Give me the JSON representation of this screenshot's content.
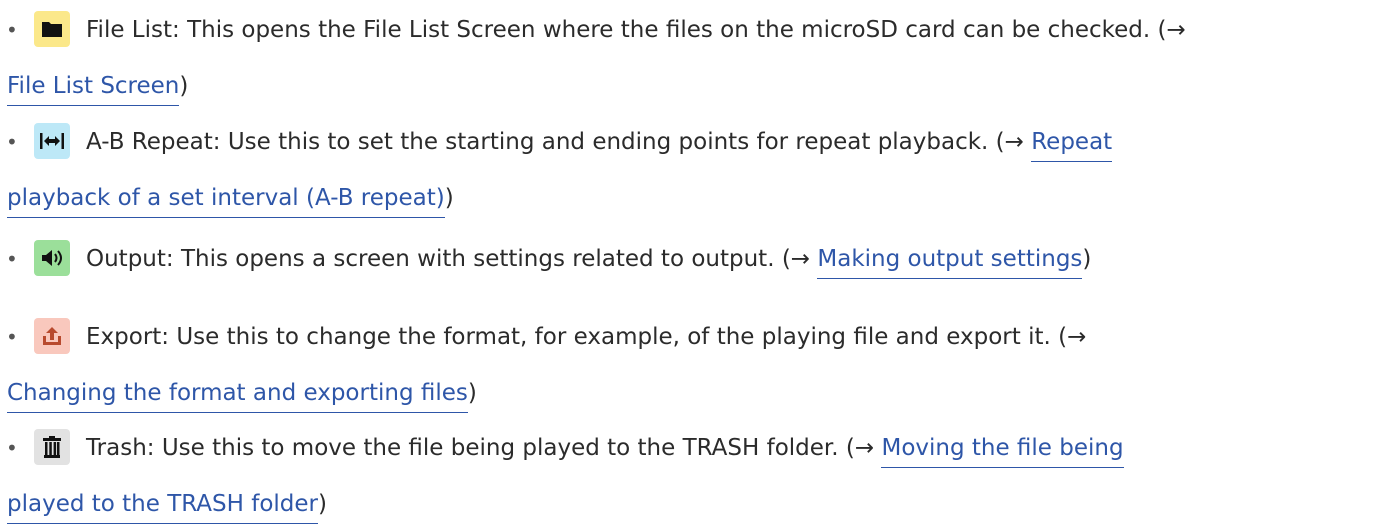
{
  "items": [
    {
      "icon": "folder-icon",
      "icon_bg": "#fbe88a",
      "text": "File List: This opens the File List Screen where the files on the microSD card can be checked. (→",
      "link": "File List Screen",
      "close": ")"
    },
    {
      "icon": "ab-repeat-icon",
      "icon_bg": "#bde8f7",
      "text": "A-B Repeat: Use this to set the starting and ending points for repeat playback. (→ ",
      "link_a": "Repeat",
      "link_b": "playback of a set interval (A-B repeat)",
      "close": ")"
    },
    {
      "icon": "speaker-icon",
      "icon_bg": "#9bdf9a",
      "text": "Output: This opens a screen with settings related to output. (→ ",
      "link": "Making output settings",
      "close": ")"
    },
    {
      "icon": "export-icon",
      "icon_bg": "#f9c8bd",
      "text": "Export: Use this to change the format, for example, of the playing file and export it. (→",
      "link": "Changing the format and exporting files",
      "close": ")"
    },
    {
      "icon": "trash-icon",
      "icon_bg": "#e2e2e2",
      "text": "Trash: Use this to move the file being played to the TRASH folder. (→ ",
      "link_a": "Moving the file being",
      "link_b": "played to the TRASH folder",
      "close": ")"
    }
  ],
  "bullet": "•",
  "colors": {
    "link": "#2e56a8",
    "text": "#2b2b2b"
  }
}
